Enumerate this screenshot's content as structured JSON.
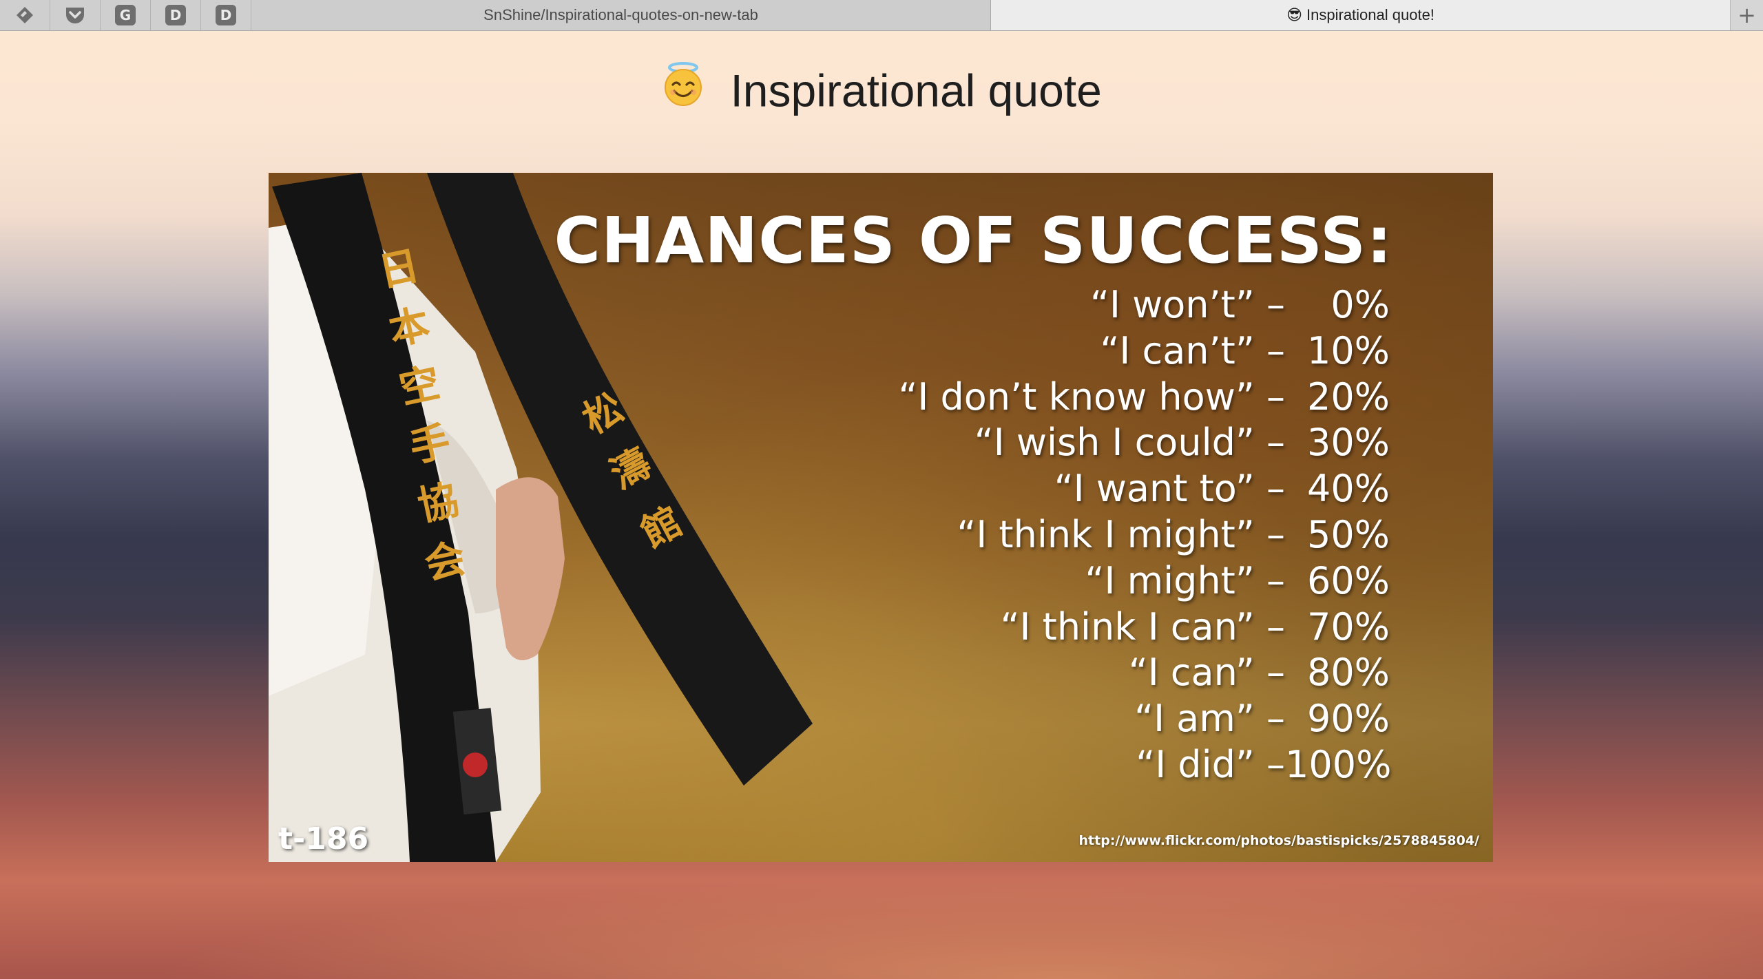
{
  "browser": {
    "pinned_tabs": [
      {
        "name": "kanbanflow-icon",
        "glyph": "◆"
      },
      {
        "name": "pocket-icon",
        "glyph": "⌄"
      },
      {
        "name": "g-icon",
        "glyph": "G"
      },
      {
        "name": "d-icon",
        "glyph": "D"
      },
      {
        "name": "d-icon",
        "glyph": "D"
      }
    ],
    "tabs": [
      {
        "label": "SnShine/Inspirational-quotes-on-new-tab",
        "active": false
      },
      {
        "label": "Inspirational quote!",
        "emoji": "😎",
        "active": true
      }
    ],
    "new_tab_glyph": "+"
  },
  "page": {
    "heading_icon": "smiling-face-with-halo-icon",
    "heading": "Inspirational quote"
  },
  "quote": {
    "title": "CHANCES OF SUCCESS:",
    "lines": [
      {
        "phrase": "“I won’t” –",
        "pct": "0%"
      },
      {
        "phrase": "“I can’t” –",
        "pct": "10%"
      },
      {
        "phrase": "“I don’t know how” –",
        "pct": "20%"
      },
      {
        "phrase": "“I wish I could” –",
        "pct": "30%"
      },
      {
        "phrase": "“I want to” –",
        "pct": "40%"
      },
      {
        "phrase": "“I think I might” –",
        "pct": "50%"
      },
      {
        "phrase": "“I might” –",
        "pct": "60%"
      },
      {
        "phrase": "“I think I can” –",
        "pct": "70%"
      },
      {
        "phrase": "“I can” –",
        "pct": "80%"
      },
      {
        "phrase": "“I am” –",
        "pct": "90%"
      },
      {
        "phrase": "“I did” –",
        "pct": "100%"
      }
    ],
    "code": "t-186",
    "source_url": "http://www.flickr.com/photos/bastispicks/2578845804/"
  },
  "colors": {
    "belt_black": "#141414",
    "embroidery_gold": "#d89a2a",
    "text_white": "#ffffff"
  }
}
